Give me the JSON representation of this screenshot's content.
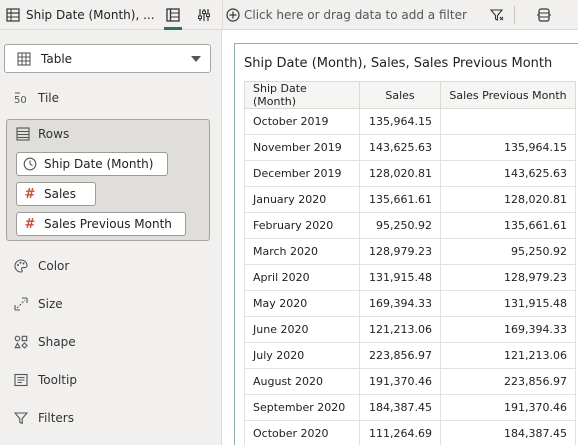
{
  "toolbar": {
    "tab_label": "Ship Date (Month), ...",
    "filter_placeholder": "Click here or drag data to add a filter"
  },
  "left_panel": {
    "viz_type": "Table",
    "tile_label": "Tile",
    "rows_label": "Rows",
    "row_pills": [
      "Ship Date (Month)",
      "Sales",
      "Sales Previous Month"
    ],
    "sections": {
      "color": "Color",
      "size": "Size",
      "shape": "Shape",
      "tooltip": "Tooltip",
      "filters": "Filters"
    }
  },
  "table": {
    "title": "Ship Date (Month), Sales, Sales Previous Month",
    "columns": [
      "Ship Date (Month)",
      "Sales",
      "Sales Previous Month"
    ],
    "rows": [
      [
        "October 2019",
        "135,964.15",
        ""
      ],
      [
        "November 2019",
        "143,625.63",
        "135,964.15"
      ],
      [
        "December 2019",
        "128,020.81",
        "143,625.63"
      ],
      [
        "January 2020",
        "135,661.61",
        "128,020.81"
      ],
      [
        "February 2020",
        "95,250.92",
        "135,661.61"
      ],
      [
        "March 2020",
        "128,979.23",
        "95,250.92"
      ],
      [
        "April 2020",
        "131,915.48",
        "128,979.23"
      ],
      [
        "May 2020",
        "169,394.33",
        "131,915.48"
      ],
      [
        "June 2020",
        "121,213.06",
        "169,394.33"
      ],
      [
        "July 2020",
        "223,856.97",
        "121,213.06"
      ],
      [
        "August 2020",
        "191,370.46",
        "223,856.97"
      ],
      [
        "September 2020",
        "184,387.45",
        "191,370.46"
      ],
      [
        "October 2020",
        "111,264.69",
        "184,387.45"
      ]
    ]
  },
  "colors": {
    "accent": "#2f6f5c",
    "measure_hash": "#c6533a",
    "panel_bg": "#f1f0ee"
  }
}
